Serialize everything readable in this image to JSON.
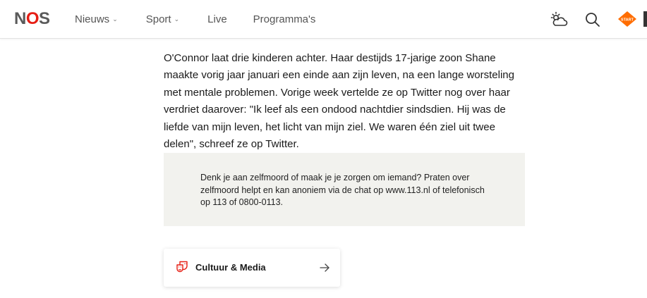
{
  "header": {
    "logo_text": "NOS",
    "nav": [
      {
        "label": "Nieuws",
        "has_dropdown": true
      },
      {
        "label": "Sport",
        "has_dropdown": true
      },
      {
        "label": "Live",
        "has_dropdown": false
      },
      {
        "label": "Programma's",
        "has_dropdown": false
      }
    ],
    "chevron": "⌄",
    "icons": [
      "weather-icon",
      "search-icon",
      "npo-start-icon"
    ],
    "npo_badge": "START"
  },
  "article": {
    "paragraph": "O'Connor laat drie kinderen achter. Haar destijds 17-jarige zoon Shane maakte vorig jaar januari een einde aan zijn leven, na een lange worsteling met mentale problemen. Vorige week vertelde ze op Twitter nog over haar verdriet daarover: \"Ik leef als een ondood nachtdier sindsdien. Hij was de liefde van mijn leven, het licht van mijn ziel. We waren één ziel uit twee delen\", schreef ze op Twitter."
  },
  "notice": {
    "text": "Denk je aan zelfmoord of maak je je zorgen om iemand? Praten over zelfmoord helpt en kan anoniem via de chat op www.113.nl of telefonisch op 113 of 0800-0113."
  },
  "topic": {
    "label": "Cultuur & Media",
    "icon": "theater-masks-icon"
  },
  "colors": {
    "accent": "#e61e14",
    "notice_bg": "#f2f2ee",
    "npo_orange": "#ff6d00"
  }
}
